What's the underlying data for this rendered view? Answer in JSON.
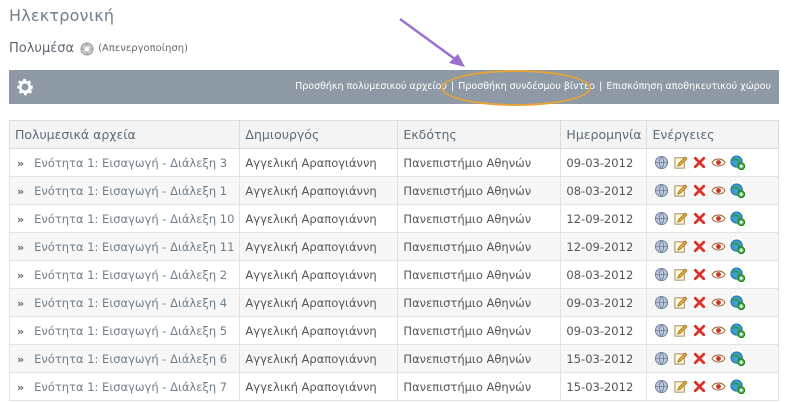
{
  "course": {
    "title": "Ηλεκτρονική"
  },
  "module": {
    "name": "Πολυμέσα",
    "status_link": "(Απενεργοποίηση)"
  },
  "toolbar": {
    "links": [
      "Προσθήκη πολυμεσικού αρχείου",
      "Προσθήκη συνδέσμου βίντεο",
      "Επισκόπηση αποθηκευτικού χώρου"
    ],
    "separator": "|",
    "highlighted": "Προσθήκη συνδέσμου βίντεο"
  },
  "table": {
    "headers": [
      "Πολυμεσικά αρχεία",
      "Δημιουργός",
      "Εκδότης",
      "Ημερομηνία",
      "Ενέργειες"
    ],
    "bullet": "»",
    "rows": [
      {
        "title": "Ενότητα 1: Εισαγωγή - Διάλεξη 3",
        "creator": "Αγγελική Αραπογιάννη",
        "publisher": "Πανεπιστήμιο Αθηνών",
        "date": "09-03-2012"
      },
      {
        "title": "Ενότητα 1: Εισαγωγή - Διάλεξη 1",
        "creator": "Αγγελική Αραπογιάννη",
        "publisher": "Πανεπιστήμιο Αθηνών",
        "date": "08-03-2012"
      },
      {
        "title": "Ενότητα 1: Εισαγωγή - Διάλεξη 10",
        "creator": "Αγγελική Αραπογιάννη",
        "publisher": "Πανεπιστήμιο Αθηνών",
        "date": "12-09-2012"
      },
      {
        "title": "Ενότητα 1: Εισαγωγή - Διάλεξη 11",
        "creator": "Αγγελική Αραπογιάννη",
        "publisher": "Πανεπιστήμιο Αθηνών",
        "date": "12-09-2012"
      },
      {
        "title": "Ενότητα 1: Εισαγωγή - Διάλεξη 2",
        "creator": "Αγγελική Αραπογιάννη",
        "publisher": "Πανεπιστήμιο Αθηνών",
        "date": "08-03-2012"
      },
      {
        "title": "Ενότητα 1: Εισαγωγή - Διάλεξη 4",
        "creator": "Αγγελική Αραπογιάννη",
        "publisher": "Πανεπιστήμιο Αθηνών",
        "date": "09-03-2012"
      },
      {
        "title": "Ενότητα 1: Εισαγωγή - Διάλεξη 5",
        "creator": "Αγγελική Αραπογιάννη",
        "publisher": "Πανεπιστήμιο Αθηνών",
        "date": "09-03-2012"
      },
      {
        "title": "Ενότητα 1: Εισαγωγή - Διάλεξη 6",
        "creator": "Αγγελική Αραπογιάννη",
        "publisher": "Πανεπιστήμιο Αθηνών",
        "date": "15-03-2012"
      },
      {
        "title": "Ενότητα 1: Εισαγωγή - Διάλεξη 7",
        "creator": "Αγγελική Αραπογιάννη",
        "publisher": "Πανεπιστήμιο Αθηνών",
        "date": "15-03-2012"
      }
    ],
    "action_icons": [
      "globe-icon",
      "edit-icon",
      "delete-icon",
      "visibility-icon",
      "add-resource-icon"
    ]
  },
  "colors": {
    "toolbar_bg": "#8d9aa5",
    "highlight_oval": "#e8a23a",
    "annotation_arrow": "#9b6fd0",
    "link": "#6f7f8d",
    "delete": "#d8342a"
  }
}
